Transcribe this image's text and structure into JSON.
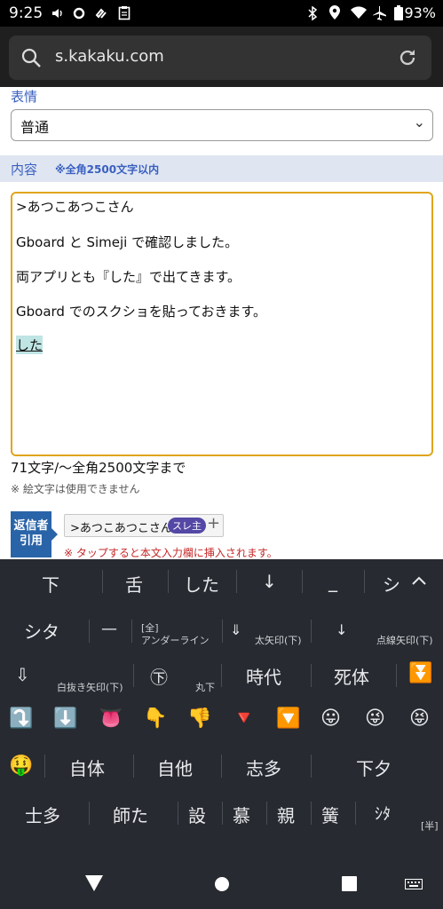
{
  "status": {
    "time": "9:25",
    "battery": "93%",
    "left_icons": [
      "volume-icon",
      "circle-icon",
      "sync-icon",
      "clipboard-icon"
    ],
    "right_icons": [
      "bluetooth-icon",
      "location-icon",
      "wifi-icon",
      "airplane-icon",
      "battery-icon"
    ]
  },
  "browser": {
    "url": "s.kakaku.com"
  },
  "form": {
    "face_label": "表情",
    "face_value": "普通",
    "content_label": "内容",
    "content_hint": "※全角2500文字以内",
    "lines": [
      ">あつこあつこさん",
      "Gboard と Simeji で確認しました。",
      "両アプリとも『した』で出てきます。",
      "Gboard でのスクショを貼っておきます。",
      "した"
    ],
    "count": "71文字/～全角2500文字まで",
    "emoji_note": "※ 絵文字は使用できません",
    "quote_label_1": "返信者",
    "quote_label_2": "引用",
    "quote_chip": ">あつこあつこさん",
    "quote_badge": "スレ主",
    "quote_plus": "+",
    "tap_note": "※ タップすると本文入力欄に挿入されます。"
  },
  "keyboard": {
    "candidates": [
      "下",
      "舌",
      "した",
      "↓",
      "_",
      "シ"
    ],
    "row1": {
      "k1": "シタ",
      "k2": "—",
      "k3_top": "[全]",
      "k3_bottom": "アンダーライン",
      "k4": "⇓",
      "k4_label": "太矢印(下)",
      "k5": "↓",
      "k5_label": "点線矢印(下)"
    },
    "row2": {
      "k1": "⇩",
      "k1_label": "白抜き矢印(下)",
      "k2": "㊦",
      "k2_label": "丸下",
      "k3": "時代",
      "k4": "死体",
      "k5": "⏬"
    },
    "row3_emoji": [
      "⤵️",
      "⬇️",
      "👅",
      "👇",
      "👎",
      "🔻",
      "🔽",
      "😛",
      "😜",
      "😝"
    ],
    "row4": [
      "🤑",
      "自体",
      "自他",
      "志多",
      "下夕"
    ],
    "row5": [
      "士多",
      "師た",
      "設",
      "慕",
      "親",
      "簧",
      "ｼﾀ"
    ],
    "row5_tag": "[半]"
  }
}
